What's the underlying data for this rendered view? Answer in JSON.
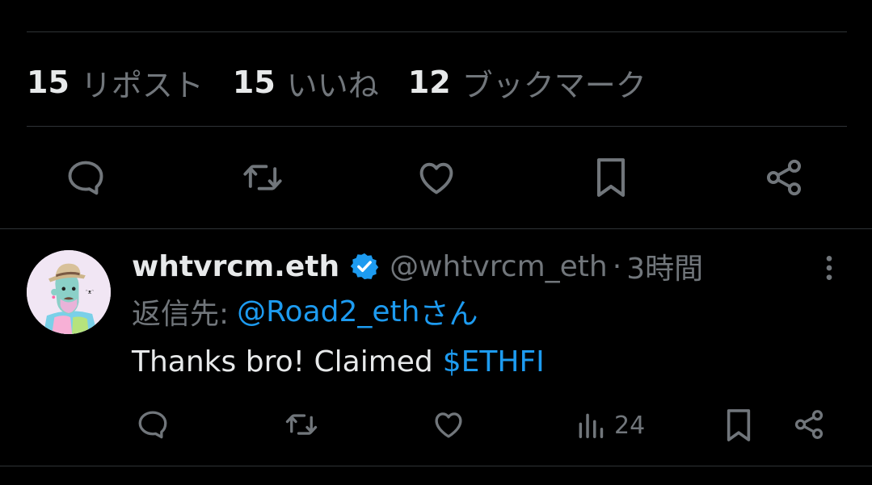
{
  "stats": {
    "reposts": {
      "count": "15",
      "label": "リポスト"
    },
    "likes": {
      "count": "15",
      "label": "いいね"
    },
    "bookmarks": {
      "count": "12",
      "label": "ブックマーク"
    }
  },
  "main_actions": [
    "reply-icon",
    "repost-icon",
    "like-icon",
    "bookmark-icon",
    "share-icon"
  ],
  "reply": {
    "author_name": "whtvrcm.eth",
    "handle": "@whtvrcm_eth",
    "separator": "·",
    "time": "3時間",
    "reply_to_prefix": "返信先:",
    "reply_to_user": "@Road2_eth",
    "reply_to_suffix": "さん",
    "text": "Thanks bro! Claimed",
    "cashtag": "$ETHFI",
    "views": "24"
  },
  "colors": {
    "background": "#000000",
    "text_primary": "#e7e9ea",
    "text_secondary": "#71767b",
    "accent": "#1d9bf0",
    "divider": "#2f3336"
  }
}
